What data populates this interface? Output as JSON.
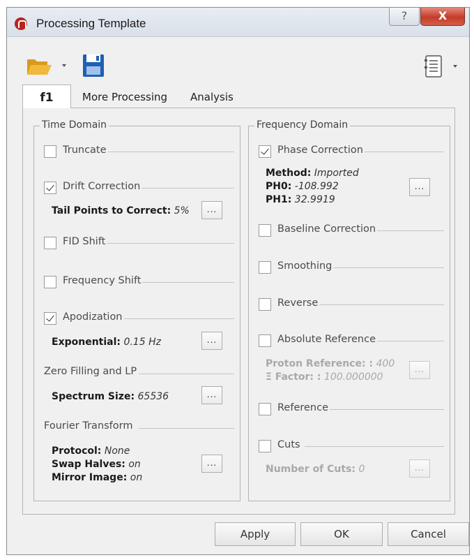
{
  "window": {
    "title": "Processing Template",
    "help_glyph": "?",
    "close_glyph": "X"
  },
  "tabs": [
    "f1",
    "More Processing",
    "Analysis"
  ],
  "time_domain": {
    "title": "Time Domain",
    "truncate": {
      "label": "Truncate",
      "checked": false
    },
    "drift_correction": {
      "label": "Drift Correction",
      "checked": true,
      "param_label": "Tail Points to Correct:",
      "param_value": "5%"
    },
    "fid_shift": {
      "label": "FID Shift",
      "checked": false
    },
    "frequency_shift": {
      "label": "Frequency Shift",
      "checked": false
    },
    "apodization": {
      "label": "Apodization",
      "checked": true,
      "param_label": "Exponential:",
      "param_value": "0.15 Hz"
    },
    "zero_filling": {
      "label": "Zero Filling and LP",
      "param_label": "Spectrum Size:",
      "param_value": "65536"
    },
    "fourier": {
      "label": "Fourier Transform",
      "protocol_label": "Protocol:",
      "protocol_value": "None",
      "swap_label": "Swap Halves:",
      "swap_value": "on",
      "mirror_label": "Mirror Image:",
      "mirror_value": "on"
    }
  },
  "frequency_domain": {
    "title": "Frequency Domain",
    "phase_correction": {
      "label": "Phase Correction",
      "checked": true,
      "method_label": "Method:",
      "method_value": "Imported",
      "ph0_label": "PH0:",
      "ph0_value": "-108.992",
      "ph1_label": "PH1:",
      "ph1_value": "32.9919"
    },
    "baseline_correction": {
      "label": "Baseline Correction",
      "checked": false
    },
    "smoothing": {
      "label": "Smoothing",
      "checked": false
    },
    "reverse": {
      "label": "Reverse",
      "checked": false
    },
    "absolute_reference": {
      "label": "Absolute Reference",
      "checked": false,
      "proton_label": "Proton Reference: :",
      "proton_value": "400",
      "factor_label": "Ξ Factor: :",
      "factor_value": "100.000000"
    },
    "reference": {
      "label": "Reference",
      "checked": false
    },
    "cuts": {
      "label": "Cuts",
      "checked": false,
      "param_label": "Number of Cuts:",
      "param_value": "0"
    }
  },
  "ellipsis": "...",
  "buttons": {
    "apply": "Apply",
    "ok": "OK",
    "cancel": "Cancel"
  }
}
